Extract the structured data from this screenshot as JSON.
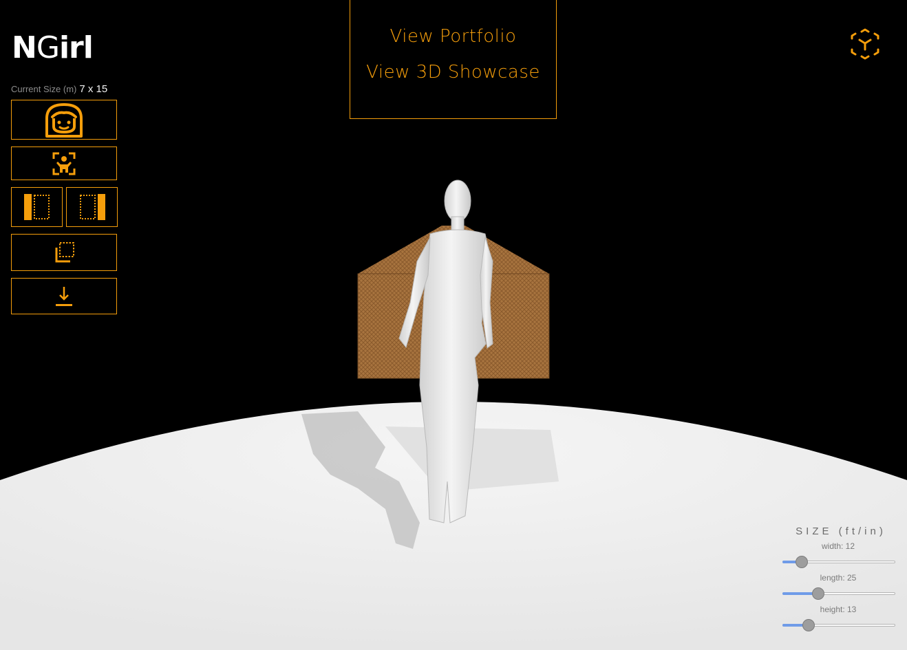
{
  "brand": {
    "part1": "N",
    "part2": "G",
    "part3": "irl"
  },
  "current_size": {
    "label": "Current Size (m)",
    "value": "7 x 15"
  },
  "toolbar": {
    "buttons": [
      {
        "icon": "girl-face-icon"
      },
      {
        "icon": "person-focus-icon"
      },
      {
        "icon": "panel-left-icon"
      },
      {
        "icon": "panel-right-icon"
      },
      {
        "icon": "copy-layers-icon"
      },
      {
        "icon": "download-icon"
      }
    ]
  },
  "menu": {
    "portfolio": "View Portfolio",
    "showcase": "View 3D Showcase"
  },
  "ar_button": {
    "icon": "ar-cube-icon"
  },
  "size_panel": {
    "title": "SIZE (ft/in)",
    "sliders": [
      {
        "label": "width: 12",
        "fraction": 0.17
      },
      {
        "label": "length: 25",
        "fraction": 0.32
      },
      {
        "label": "height: 13",
        "fraction": 0.23
      }
    ]
  },
  "colors": {
    "accent": "#f59e0b",
    "background": "#000000",
    "ground": "#efefef",
    "slider_fill": "#6f9be8"
  }
}
